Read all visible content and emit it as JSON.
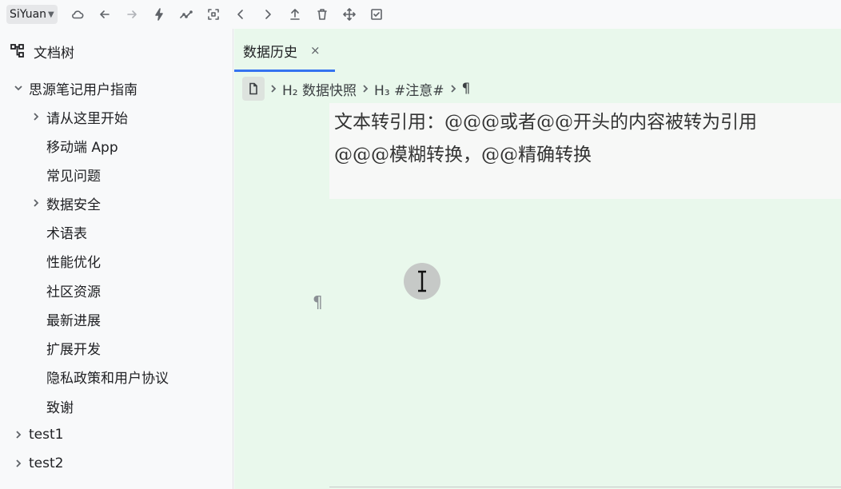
{
  "toolbar": {
    "workspace_label": "SiYuan",
    "icons": [
      "cloud-icon",
      "back-icon",
      "forward-icon",
      "lightning-icon",
      "graph-icon",
      "focus-icon",
      "prev-icon",
      "next-icon",
      "upload-icon",
      "trash-icon",
      "move-icon",
      "checkbox-icon"
    ]
  },
  "sidebar": {
    "title": "文档树",
    "notebook": "思源笔记用户指南",
    "items": [
      {
        "label": "请从这里开始",
        "has_children": true
      },
      {
        "label": "移动端 App",
        "has_children": false
      },
      {
        "label": "常见问题",
        "has_children": false
      },
      {
        "label": "数据安全",
        "has_children": true
      },
      {
        "label": "术语表",
        "has_children": false
      },
      {
        "label": "性能优化",
        "has_children": false
      },
      {
        "label": "社区资源",
        "has_children": false
      },
      {
        "label": "最新进展",
        "has_children": false
      },
      {
        "label": "扩展开发",
        "has_children": false
      },
      {
        "label": "隐私政策和用户协议",
        "has_children": false
      },
      {
        "label": "致谢",
        "has_children": false
      }
    ],
    "other_notebooks": [
      "test1",
      "test2"
    ]
  },
  "editor": {
    "tab_label": "数据历史",
    "tab_close": "×",
    "breadcrumb": {
      "h2": "H₂ 数据快照",
      "h3": "H₃ #注意#",
      "pilcrow": "¶"
    },
    "content": {
      "line1": "文本转引用：@@@或者@@开头的内容被转为引用",
      "line2": "@@@模糊转换，@@精确转换"
    },
    "empty_para_mark": "¶"
  },
  "colors": {
    "editor_bg": "#e9f8ec",
    "sidebar_bg": "#f8f9fa",
    "tab_underline": "#3573f0"
  }
}
